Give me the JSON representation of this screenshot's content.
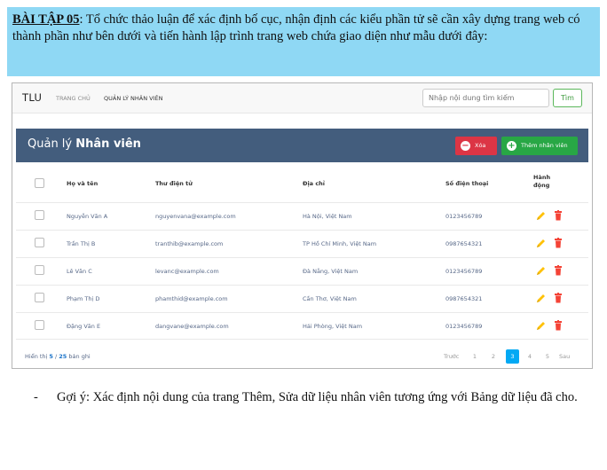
{
  "task": {
    "lead": "BÀI TẬP 05",
    "text": ": Tổ chức thảo luận để xác định bố cục, nhận định các kiểu phần tử sẽ cần xây dựng trang web có thành phần như bên dưới và tiến hành lập trình trang web chứa giao diện như mẫu dưới đây:"
  },
  "navbar": {
    "brand": "TLU",
    "items": [
      "TRANG CHỦ",
      "QUẢN LÝ NHÂN VIÊN"
    ],
    "search_placeholder": "Nhập nội dung tìm kiếm",
    "search_button": "Tìm"
  },
  "panel": {
    "title_prefix": "Quản lý ",
    "title_bold": "Nhân viên",
    "delete_button": "Xóa",
    "add_button": "Thêm nhân viên"
  },
  "table": {
    "headers": [
      "Họ và tên",
      "Thư điện tử",
      "Địa chỉ",
      "Số điện thoại",
      "Hành động"
    ],
    "rows": [
      [
        "Nguyễn Văn A",
        "nguyenvana@example.com",
        "Hà Nội, Việt Nam",
        "0123456789"
      ],
      [
        "Trần Thị B",
        "tranthib@example.com",
        "TP Hồ Chí Minh, Việt Nam",
        "0987654321"
      ],
      [
        "Lê Văn C",
        "levanc@example.com",
        "Đà Nẵng, Việt Nam",
        "0123456789"
      ],
      [
        "Phạm Thị D",
        "phamthid@example.com",
        "Cần Thơ, Việt Nam",
        "0987654321"
      ],
      [
        "Đặng Văn E",
        "dangvane@example.com",
        "Hải Phòng, Việt Nam",
        "0123456789"
      ]
    ]
  },
  "footer": {
    "showing_prefix": "Hiển thị ",
    "shown": "5",
    "separator": " / ",
    "total": "25",
    "suffix": " bản ghi",
    "pagination": [
      "Trước",
      "1",
      "2",
      "3",
      "4",
      "5",
      "Sau"
    ],
    "active_page": "3"
  },
  "hint": {
    "bullet": "-",
    "text": "Gợi ý: Xác định nội dung của trang Thêm, Sửa dữ liệu nhân viên tương ứng với Bảng dữ liệu đã cho."
  },
  "colors": {
    "task_box": "#8fd8f4",
    "title_bar": "#435d7d",
    "delete": "#dc3545",
    "add": "#28a745",
    "edit_icon": "#ffc107",
    "active_page": "#03a9f4"
  },
  "icons": {
    "edit": "pencil-icon",
    "delete": "trash-icon",
    "delete_button": "minus-circle-icon",
    "add_button": "plus-circle-icon"
  }
}
